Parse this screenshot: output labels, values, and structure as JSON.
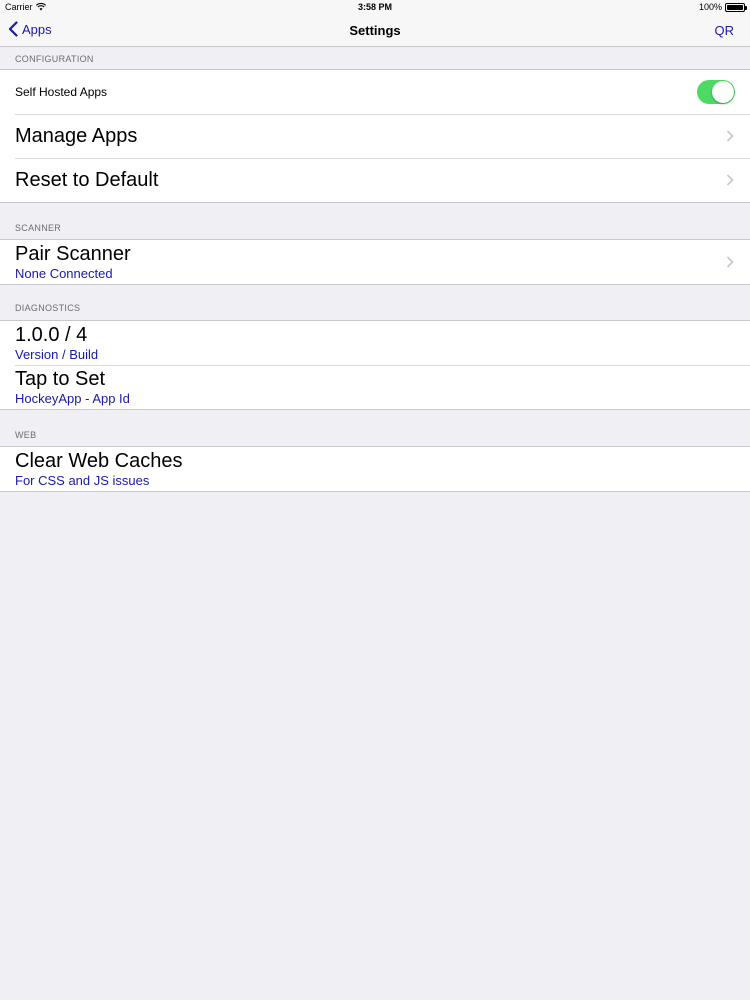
{
  "status_bar": {
    "carrier": "Carrier",
    "time": "3:58 PM",
    "battery_text": "100%",
    "battery_level": 1.0
  },
  "nav": {
    "back_label": "Apps",
    "title": "Settings",
    "right_label": "QR"
  },
  "sections": {
    "configuration": {
      "header": "CONFIGURATION",
      "self_hosted_label": "Self Hosted Apps",
      "self_hosted_on": true,
      "manage_apps": "Manage Apps",
      "reset_default": "Reset to Default"
    },
    "scanner": {
      "header": "SCANNER",
      "pair_title": "Pair Scanner",
      "pair_sub": "None Connected"
    },
    "diagnostics": {
      "header": "DIAGNOSTICS",
      "version_title": "1.0.0 / 4",
      "version_sub": "Version / Build",
      "hockey_title": "Tap to Set",
      "hockey_sub": "HockeyApp - App Id"
    },
    "web": {
      "header": "WEB",
      "clear_title": "Clear Web Caches",
      "clear_sub": "For CSS and JS issues"
    }
  },
  "colors": {
    "accent": "#1a1aa6",
    "toggle_on": "#4cd964",
    "background": "#efeff4"
  }
}
